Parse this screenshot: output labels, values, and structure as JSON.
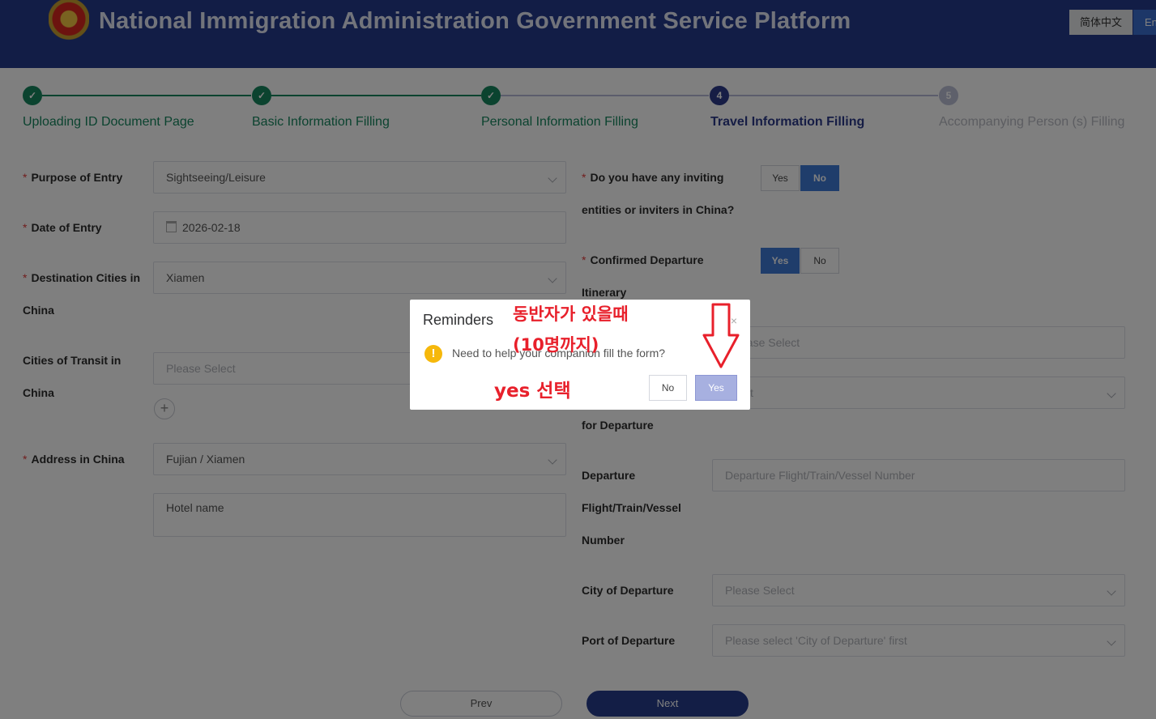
{
  "header": {
    "title": "National Immigration Administration Government Service Platform",
    "lang_cn": "简体中文",
    "lang_en": "English"
  },
  "steps": [
    {
      "number": "1",
      "label": "Uploading ID Document Page",
      "status": "done"
    },
    {
      "number": "2",
      "label": "Basic Information Filling",
      "status": "done"
    },
    {
      "number": "3",
      "label": "Personal Information Filling",
      "status": "done"
    },
    {
      "number": "4",
      "label": "Travel Information Filling",
      "status": "active"
    },
    {
      "number": "5",
      "label": "Accompanying Person (s) Filling",
      "status": "todo"
    }
  ],
  "left_form": {
    "purpose_label": "Purpose of Entry",
    "purpose_value": "Sightseeing/Leisure",
    "date_label": "Date of Entry",
    "date_value": "2026-02-18",
    "dest_label_1": "Destination Cities in",
    "dest_label_2": "China",
    "dest_value": "Xiamen",
    "transit_label_1": "Cities of Transit in",
    "transit_label_2": "China",
    "transit_placeholder": "Please Select",
    "address_label": "Address in China",
    "address_value": "Fujian / Xiamen",
    "hotel_value": "Hotel name"
  },
  "right_form": {
    "inviting_label_1": "Do you have any inviting",
    "inviting_label_2": "entities or inviters in China?",
    "inviting_yes": "Yes",
    "inviting_no": "No",
    "confirmed_label_1": "Confirmed Departure",
    "confirmed_label_2": "Itinerary",
    "confirmed_yes": "Yes",
    "confirmed_no": "No",
    "hidden_select_placeholder": "ease Select",
    "hidden_select2_value": "t",
    "departure_for_label": "for Departure",
    "flight_label_1": "Departure",
    "flight_label_2": "Flight/Train/Vessel",
    "flight_label_3": "Number",
    "flight_placeholder": "Departure Flight/Train/Vessel Number",
    "city_label": "City of Departure",
    "city_placeholder": "Please Select",
    "port_label": "Port of Departure",
    "port_placeholder": "Please select 'City of Departure' first"
  },
  "nav": {
    "prev": "Prev",
    "next": "Next"
  },
  "dialog": {
    "title": "Reminders",
    "close": "×",
    "message": "Need to help your companion fill the form?",
    "no": "No",
    "yes": "Yes"
  },
  "annotations": {
    "line1": "동반자가 있을때",
    "line2": "(10명까지)",
    "line3": "yes 선택"
  },
  "colors": {
    "header": "#253a8c",
    "done": "#16865f",
    "active": "#2c3b8b",
    "annotation": "#e8202b"
  }
}
